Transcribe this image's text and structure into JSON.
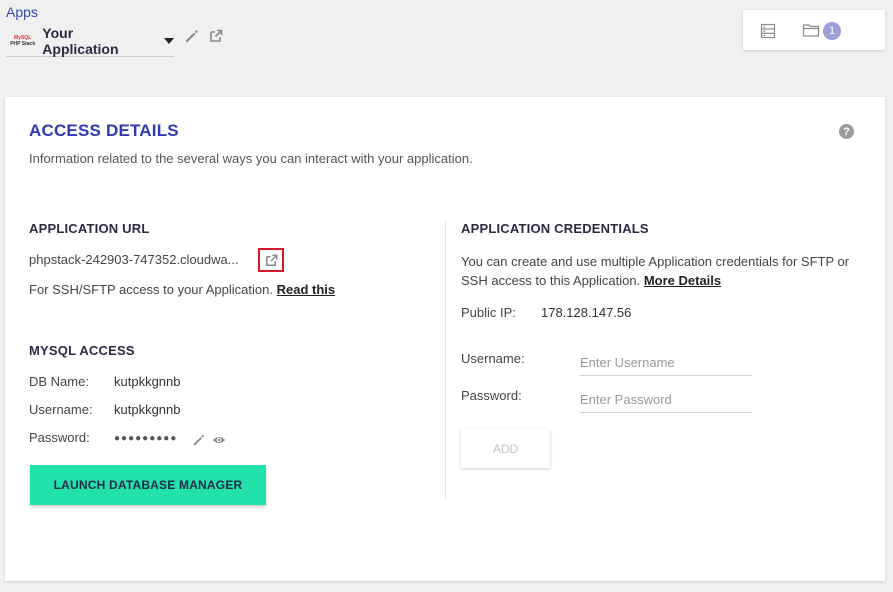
{
  "header": {
    "apps_link": "Apps",
    "app_logo_line1": "MySQL",
    "app_logo_line2": "PHP Stack",
    "app_name": "Your Application",
    "server_count": "1"
  },
  "access": {
    "title": "ACCESS DETAILS",
    "description": "Information related to the several ways you can interact with your application."
  },
  "app_url": {
    "title": "APPLICATION URL",
    "url": "phpstack-242903-747352.cloudwa...",
    "ssh_text": "For SSH/SFTP access to your Application.",
    "read_this": "Read this"
  },
  "mysql": {
    "title": "MYSQL ACCESS",
    "db_name_label": "DB Name:",
    "db_name": "kutpkkgnnb",
    "username_label": "Username:",
    "username": "kutpkkgnnb",
    "password_label": "Password:",
    "password_masked": "●●●●●●●●●",
    "launch_button": "LAUNCH DATABASE MANAGER"
  },
  "credentials": {
    "title": "APPLICATION CREDENTIALS",
    "description": "You can create and use multiple Application credentials for SFTP or SSH access to this Application.",
    "more_details": "More Details",
    "public_ip_label": "Public IP:",
    "public_ip": "178.128.147.56",
    "username_label": "Username:",
    "username_placeholder": "Enter Username",
    "password_label": "Password:",
    "password_placeholder": "Enter Password",
    "add_button": "ADD"
  },
  "colors": {
    "accent": "#2d3ab3",
    "launch_button": "#22e1aa",
    "highlight_border": "#d11b2a",
    "badge": "#9b9fd9"
  }
}
